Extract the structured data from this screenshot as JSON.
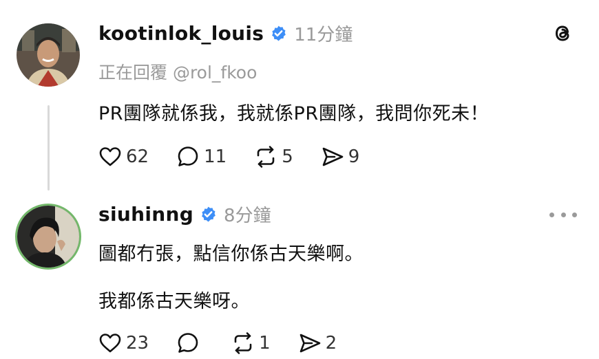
{
  "post1": {
    "username": "kootinlok_louis",
    "verified_icon": "verified-badge-icon",
    "time": "11分鐘",
    "replying_to": "正在回覆 @rol_fkoo",
    "text": "PR團隊就係我，我就係PR團隊，我問你死未！",
    "likes": "62",
    "replies": "11",
    "reposts": "5",
    "shares": "9"
  },
  "post2": {
    "username": "siuhinng",
    "verified_icon": "verified-badge-icon",
    "time": "8分鐘",
    "text_line1": "圖都冇張，點信你係古天樂啊。",
    "text_line2": "我都係古天樂呀。",
    "likes": "23",
    "replies": "",
    "reposts": "1",
    "shares": "2"
  },
  "icons": {
    "app_logo": "threads-logo-icon",
    "like": "heart-icon",
    "reply": "comment-bubble-icon",
    "repost": "repost-icon",
    "share": "send-icon",
    "more": "more-dots-icon"
  },
  "colors": {
    "verified": "#3d8ef7",
    "secondary_text": "#999999",
    "avatar_ring": "#73b86a",
    "thread_line": "#d9d9d9"
  }
}
